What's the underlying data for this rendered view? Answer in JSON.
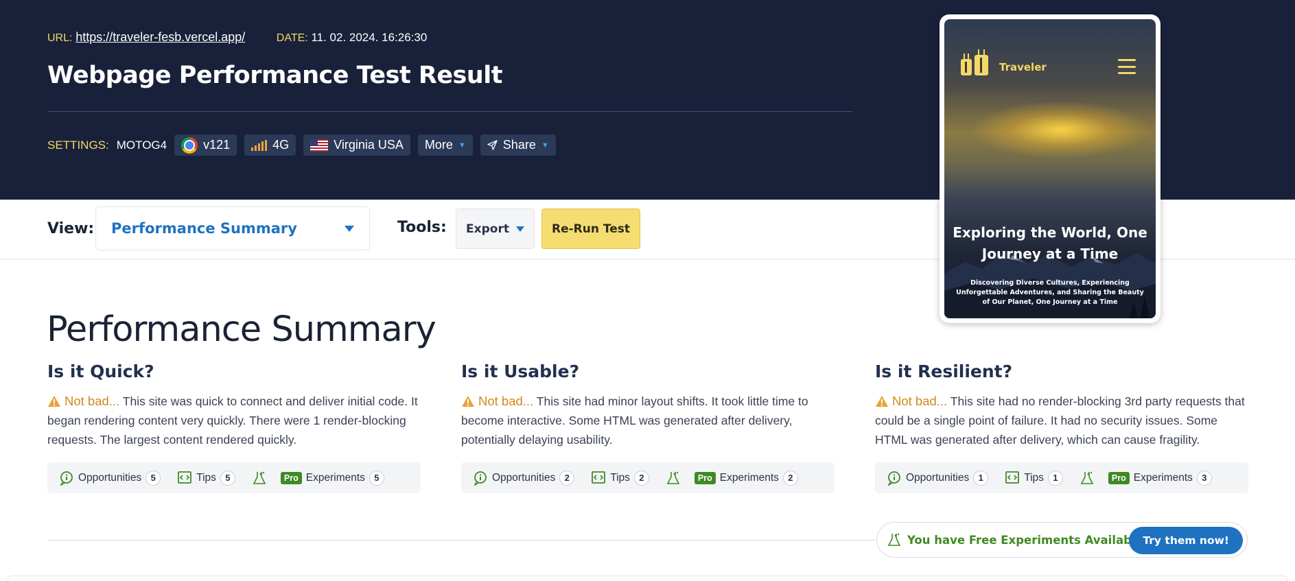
{
  "header": {
    "url_label": "URL:",
    "url": "https://traveler-fesb.vercel.app/",
    "date_label": "DATE:",
    "date": "11. 02. 2024. 16:26:30",
    "title": "Webpage Performance Test Result",
    "settings_label": "SETTINGS:",
    "device": "MOTOG4",
    "browser_version": "v121",
    "connection": "4G",
    "location": "Virginia USA",
    "more_label": "More",
    "share_label": "Share"
  },
  "toolbar": {
    "view_label": "View:",
    "view_selected": "Performance Summary",
    "tools_label": "Tools:",
    "export_label": "Export",
    "rerun_label": "Re-Run Test"
  },
  "preview": {
    "brand": "Traveler",
    "headline": "Exploring the World, One Journey at a Time",
    "subhead": "Discovering Diverse Cultures, Experiencing Unforgettable Adventures, and Sharing the Beauty of Our Planet, One Journey at a Time"
  },
  "summary": {
    "title": "Performance Summary",
    "columns": [
      {
        "heading": "Is it Quick?",
        "verdict": "Not bad...",
        "text": "This site was quick to connect and deliver initial code. It began rendering content very quickly. There were 1 render-blocking requests. The largest content rendered quickly.",
        "opportunities_label": "Opportunities",
        "opportunities": "5",
        "tips_label": "Tips",
        "tips": "5",
        "pro_label": "Pro",
        "experiments_label": "Experiments",
        "experiments": "5"
      },
      {
        "heading": "Is it Usable?",
        "verdict": "Not bad...",
        "text": "This site had minor layout shifts. It took little time to become interactive. Some HTML was generated after delivery, potentially delaying usability.",
        "opportunities_label": "Opportunities",
        "opportunities": "2",
        "tips_label": "Tips",
        "tips": "2",
        "pro_label": "Pro",
        "experiments_label": "Experiments",
        "experiments": "2"
      },
      {
        "heading": "Is it Resilient?",
        "verdict": "Not bad...",
        "text": "This site had no render-blocking 3rd party requests that could be a single point of failure. It had no security issues. Some HTML was generated after delivery, which can cause fragility.",
        "opportunities_label": "Opportunities",
        "opportunities": "1",
        "tips_label": "Tips",
        "tips": "1",
        "pro_label": "Pro",
        "experiments_label": "Experiments",
        "experiments": "3"
      }
    ],
    "free_experiments_text": "You have Free Experiments Available!",
    "try_label": "Try them now!"
  },
  "colors": {
    "header_bg": "#19213a",
    "accent_yellow": "#f3d867",
    "link_blue": "#1f72c0",
    "warn_orange": "#d3881b",
    "pro_green": "#3f8a23"
  },
  "icons": [
    "chrome-icon",
    "signal-icon",
    "us-flag-icon",
    "send-icon",
    "chevron-down-icon",
    "luggage-icon",
    "hamburger-icon",
    "warning-icon",
    "info-icon",
    "code-icon",
    "flask-icon"
  ]
}
